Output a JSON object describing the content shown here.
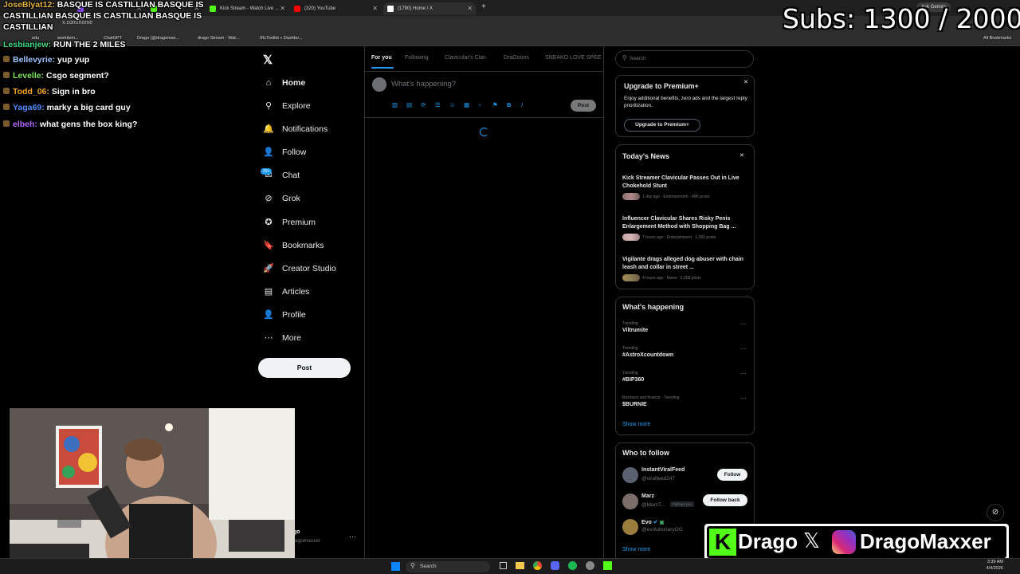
{
  "browser": {
    "tabs": [
      {
        "label": "",
        "color": "#9146ff"
      },
      {
        "label": "",
        "color": "#53fc18"
      },
      {
        "label": "Kick Stream - Watch Live ...",
        "color": "#53fc18"
      },
      {
        "label": "(320) YouTube",
        "color": "#ff0000"
      },
      {
        "label": "(1790) Home / X",
        "color": "#ffffff"
      }
    ],
    "url": "x.com/home",
    "bookmarks": [
      "edu",
      "workitem...",
      "ChatGPT",
      "Drago (@dragomax...",
      "drago Stream - Wat...",
      "IRLToolkit » Dashbo..."
    ],
    "all_bookmarks": "All Bookmarks",
    "ask_gemini": "Ask Gemini"
  },
  "chat": [
    {
      "user": "JoseBlyat12:",
      "msg": "BASQUE IS CASTILLIAN BASQUE IS",
      "color": "#e3b341"
    },
    {
      "user": "",
      "msg": "CASTILLIAN BASQUE IS CASTILLIAN BASQUE IS",
      "color": "#ffffff"
    },
    {
      "user": "",
      "msg": "CASTILLIAN",
      "color": "#ffffff"
    },
    {
      "user": "Lesbianjew:",
      "msg": "RUN THE 2 MILES",
      "color": "#3ddc84"
    },
    {
      "user": "Bellevyrie:",
      "msg": "yup yup",
      "color": "#9bc4ff"
    },
    {
      "user": "Levelle:",
      "msg": "Csgo segment?",
      "color": "#7ee35b"
    },
    {
      "user": "Todd_06:",
      "msg": "Sign in bro",
      "color": "#f5a623"
    },
    {
      "user": "Yaga69:",
      "msg": "marky a big card guy",
      "color": "#4f8cff"
    },
    {
      "user": "elbeh:",
      "msg": "what gens the box king?",
      "color": "#b36bff"
    }
  ],
  "subs": "Subs: 1300 / 2000",
  "sidebar": {
    "items": [
      {
        "label": "Home",
        "icon": "home-icon",
        "glyph": "⌂"
      },
      {
        "label": "Explore",
        "icon": "search-icon",
        "glyph": "⚲"
      },
      {
        "label": "Notifications",
        "icon": "bell-icon",
        "glyph": "🔔"
      },
      {
        "label": "Follow",
        "icon": "person-add-icon",
        "glyph": "👤"
      },
      {
        "label": "Chat",
        "icon": "chat-icon",
        "glyph": "✉"
      },
      {
        "label": "Grok",
        "icon": "grok-icon",
        "glyph": "⊘"
      },
      {
        "label": "Premium",
        "icon": "premium-icon",
        "glyph": "✪"
      },
      {
        "label": "Bookmarks",
        "icon": "bookmark-icon",
        "glyph": "🔖"
      },
      {
        "label": "Creator Studio",
        "icon": "rocket-icon",
        "glyph": "🚀"
      },
      {
        "label": "Articles",
        "icon": "articles-icon",
        "glyph": "▤"
      },
      {
        "label": "Profile",
        "icon": "profile-icon",
        "glyph": "👤"
      },
      {
        "label": "More",
        "icon": "more-icon",
        "glyph": "⋯"
      }
    ],
    "chat_badge": "20+",
    "post_button": "Post",
    "account_name": "go",
    "account_handle": "agomaxxer"
  },
  "timeline": {
    "tabs": [
      "For you",
      "Following",
      "Clavicular's Clan",
      "DraGoons",
      "SNEAKO LOVE SPEE"
    ],
    "compose_placeholder": "What's happening?",
    "post_button": "Post"
  },
  "right": {
    "search_placeholder": "Search",
    "premium": {
      "title": "Upgrade to Premium+",
      "desc": "Enjoy additional benefits, zero ads and the largest reply prioritization.",
      "button": "Upgrade to Premium+"
    },
    "news": {
      "title": "Today's News",
      "items": [
        {
          "headline": "Kick Streamer Clavicular Passes Out in Live Chokehold Stunt",
          "meta": "1 day ago · Entertainment · 49K posts"
        },
        {
          "headline": "Influencer Clavicular Shares Risky Penis Enlargement Method with Shopping Bag ...",
          "meta": "7 hours ago · Entertainment · 1,092 posts"
        },
        {
          "headline": "Vigilante drags alleged dog abuser with chain leash and collar in street ...",
          "meta": "4 hours ago · News · 2,058 posts"
        }
      ]
    },
    "happening": {
      "title": "What's happening",
      "trends": [
        {
          "cat": "Trending",
          "name": "Viltrumite"
        },
        {
          "cat": "Trending",
          "name": "#AstroXcountdown"
        },
        {
          "cat": "Trending",
          "name": "#BIP360"
        },
        {
          "cat": "Business and finance · Trending",
          "name": "$BURNIE"
        }
      ],
      "show_more": "Show more"
    },
    "follow": {
      "title": "Who to follow",
      "users": [
        {
          "name": "InstantViralFeed",
          "handle": "@viralfeed247",
          "button": "Follow",
          "extra": ""
        },
        {
          "name": "Marz",
          "handle": "@MarzT...",
          "button": "Follow back",
          "extra": "Follows you"
        },
        {
          "name": "Evo",
          "handle": "@evolutionaryOG",
          "button": "",
          "extra": ""
        }
      ],
      "show_more": "Show more"
    }
  },
  "branding": {
    "kick": "Drago",
    "x_name": "DragoMaxxer"
  },
  "taskbar": {
    "search": "Search",
    "time": "3:39 AM",
    "date": "4/4/2026"
  }
}
